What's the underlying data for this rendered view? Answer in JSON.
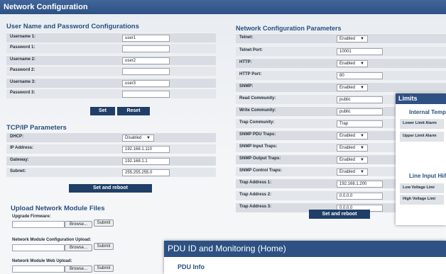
{
  "window": {
    "title": "Network Configuration"
  },
  "user_section": {
    "title": "User Name and Password Configurations",
    "rows": [
      {
        "label": "Username 1:",
        "value": "user1"
      },
      {
        "label": "Password 1:",
        "value": ""
      },
      {
        "label": "Username 2:",
        "value": "user2"
      },
      {
        "label": "Password 2:",
        "value": ""
      },
      {
        "label": "Username 3:",
        "value": "user3"
      },
      {
        "label": "Password 3:",
        "value": ""
      }
    ],
    "set_label": "Set",
    "reset_label": "Reset"
  },
  "tcpip": {
    "title": "TCP/IP Parameters",
    "rows": [
      {
        "label": "DHCP:",
        "value": "Disabled"
      },
      {
        "label": "IP Address:",
        "value": "192.168.1.110"
      },
      {
        "label": "Gateway:",
        "value": "192.168.1.1"
      },
      {
        "label": "Subnet:",
        "value": "255.255.255.0"
      }
    ],
    "button_label": "Set and reboot"
  },
  "upload": {
    "title": "Upload Network Module Files",
    "items": [
      {
        "label": "Upgrade Firmware:",
        "browse": "Browse...",
        "submit": "Submit"
      },
      {
        "label": "Network Module Configuration Upload:",
        "browse": "Browse...",
        "submit": "Submit"
      },
      {
        "label": "Network Module Web Upload:",
        "browse": "Browse...",
        "submit": "Submit"
      }
    ]
  },
  "netparams": {
    "title": "Network Configuration Parameters",
    "rows": [
      {
        "label": "Telnet:",
        "value": "Enabled"
      },
      {
        "label": "Telnet Port:",
        "value": "10001"
      },
      {
        "label": "HTTP:",
        "value": "Enabled"
      },
      {
        "label": "HTTP Port:",
        "value": "80"
      },
      {
        "label": "SNMP:",
        "value": "Enabled"
      },
      {
        "label": "Read Community:",
        "value": "public"
      },
      {
        "label": "Write Community:",
        "value": "public"
      },
      {
        "label": "Trap Community:",
        "value": "Trap"
      },
      {
        "label": "SNMP PDU Traps:",
        "value": "Enabled"
      },
      {
        "label": "SNMP Input Traps:",
        "value": "Enabled"
      },
      {
        "label": "SNMP Output Traps:",
        "value": "Enabled"
      },
      {
        "label": "SNMP Control Traps:",
        "value": "Enabled"
      },
      {
        "label": "Trap Address 1:",
        "value": "192.168.1.200"
      },
      {
        "label": "Trap Address 2:",
        "value": "0.0.0.0"
      },
      {
        "label": "Trap Address 3:",
        "value": "0.0.0.0"
      }
    ],
    "button_label": "Set and reboot"
  },
  "limits_panel": {
    "title": "Limits",
    "internal_temp_title": "Internal Temp",
    "lower_alarm_label": "Lower Limit Alarm",
    "upper_alarm_label": "Upper Limit Alarm",
    "line_input_title": "Line Input Hi/L",
    "low_voltage_label": "Low Voltage Limi",
    "high_voltage_label": "High Voltage Limi"
  },
  "pdu_panel": {
    "title": "PDU ID and Monitoring (Home)",
    "pdu_info_label": "PDU Info"
  },
  "colors": {
    "titlebar": "#2e5183",
    "heading_text": "#2a4f80",
    "button": "#1f3f68"
  }
}
